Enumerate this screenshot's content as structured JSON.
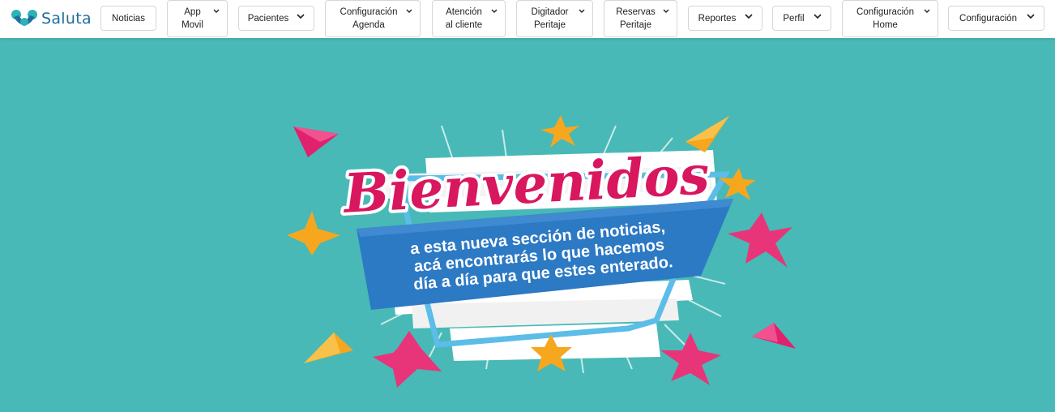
{
  "app": {
    "name": "Saluta"
  },
  "nav": {
    "noticias": "Noticias",
    "app_movil": [
      "App",
      "Movil"
    ],
    "pacientes": "Pacientes",
    "config_agenda": [
      "Configuración",
      "Agenda"
    ],
    "atencion": [
      "Atención",
      "al cliente"
    ],
    "digitador": [
      "Digitador",
      "Peritaje"
    ],
    "reservas": [
      "Reservas",
      "Peritaje"
    ],
    "reportes": "Reportes",
    "perfil": "Perfil",
    "config_home": [
      "Configuración",
      "Home"
    ],
    "configuracion": "Configuración"
  },
  "banner": {
    "title": "Bienvenidos",
    "line1": "a esta nueva sección de noticias,",
    "line2": "acá encontrarás lo que hacemos",
    "line3": "día a día para que estes enterado."
  },
  "colors": {
    "background": "#48b9b6",
    "brand": "#1f6e9c",
    "title": "#d8175f",
    "ribbon": "#2c79c4",
    "frame": "#5bbde8",
    "star_pink": "#e8357a",
    "star_orange": "#f6a71e"
  },
  "icons": [
    "saluta-logo-icon",
    "chevron-down-icon",
    "star-icon",
    "triangle-icon"
  ]
}
